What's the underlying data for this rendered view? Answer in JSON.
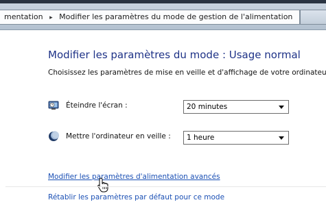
{
  "breadcrumb": {
    "segments": [
      "mentation",
      "Modifier les paramètres du mode de gestion de l'alimentation"
    ],
    "separator": "▸"
  },
  "main": {
    "title": "Modifier les paramètres du mode : Usage normal",
    "subtitle": "Choisissez les paramètres de mise en veille et d'affichage de votre ordinateur."
  },
  "settings": {
    "display_off": {
      "label": "Éteindre l'écran :",
      "value": "20 minutes",
      "icon": "monitor-icon"
    },
    "sleep": {
      "label": "Mettre l'ordinateur en veille :",
      "value": "1 heure",
      "icon": "moon-icon"
    }
  },
  "links": {
    "advanced": "Modifier les paramètres d'alimentation avancés",
    "restore": "Rétablir les paramètres par défaut pour ce mode"
  },
  "colors": {
    "link": "#1a4fb4",
    "title": "#1e3287"
  }
}
